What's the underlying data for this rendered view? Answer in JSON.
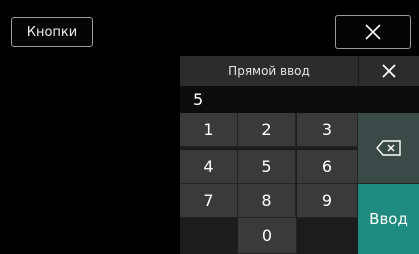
{
  "top_bar": {
    "buttons_label": "Кнопки"
  },
  "keypad": {
    "title": "Прямой ввод",
    "value": "5",
    "keys": [
      "1",
      "2",
      "3",
      "4",
      "5",
      "6",
      "7",
      "8",
      "9",
      "0"
    ],
    "enter_label": "Ввод"
  }
}
